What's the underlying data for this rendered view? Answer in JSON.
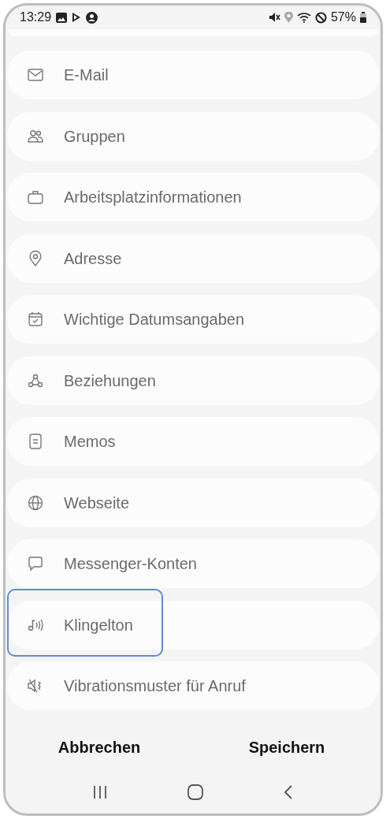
{
  "status_bar": {
    "time": "13:29",
    "battery": "57%"
  },
  "fields": [
    {
      "label": "E-Mail",
      "highlighted": false
    },
    {
      "label": "Gruppen",
      "highlighted": false
    },
    {
      "label": "Arbeitsplatzinformationen",
      "highlighted": false
    },
    {
      "label": "Adresse",
      "highlighted": false
    },
    {
      "label": "Wichtige Datumsangaben",
      "highlighted": false
    },
    {
      "label": "Beziehungen",
      "highlighted": false
    },
    {
      "label": "Memos",
      "highlighted": false
    },
    {
      "label": "Webseite",
      "highlighted": false
    },
    {
      "label": "Messenger-Konten",
      "highlighted": false
    },
    {
      "label": "Klingelton",
      "highlighted": true
    },
    {
      "label": "Vibrationsmuster für Anruf",
      "highlighted": false
    }
  ],
  "buttons": [
    {
      "label": "Abbrechen"
    },
    {
      "label": "Speichern"
    }
  ]
}
